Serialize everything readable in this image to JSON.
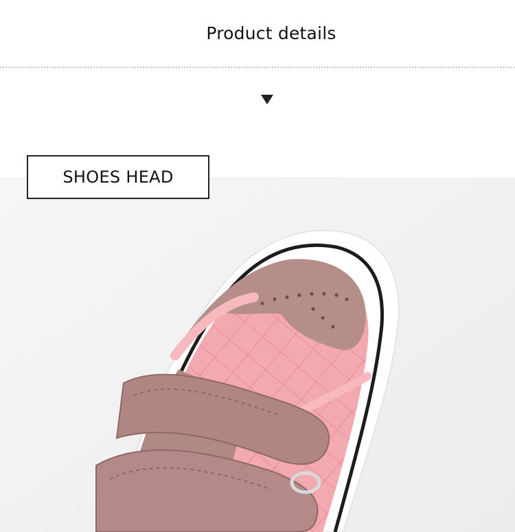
{
  "header": {
    "title": "Product details"
  },
  "section": {
    "label": "SHOES HEAD"
  },
  "image": {
    "subject": "pink-sneaker-toe",
    "colors": {
      "suede": "#b58e8a",
      "leather": "#f1a3aa",
      "sole": "#ffffff",
      "background": "#f4f4f5"
    }
  }
}
